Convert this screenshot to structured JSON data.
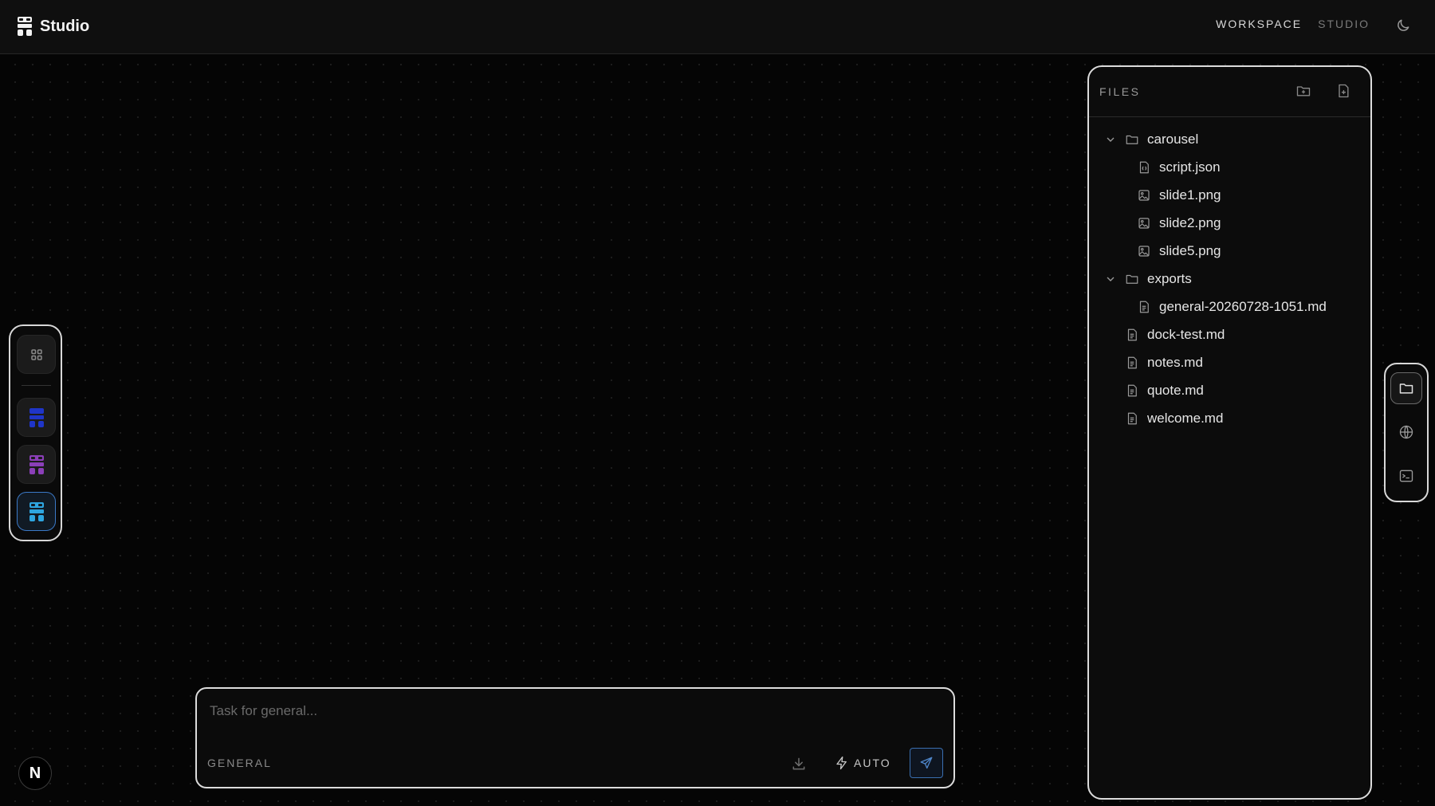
{
  "app": {
    "name": "Studio"
  },
  "nav": {
    "workspace": "WORKSPACE",
    "studio": "STUDIO"
  },
  "theme_toggle_icon": "moon-icon",
  "left_rail": {
    "items": [
      {
        "icon": "grid-icon",
        "color": "#8a8a8a"
      },
      {
        "icon": "agent-icon",
        "color": "#1f35c8"
      },
      {
        "icon": "agent-icon",
        "color": "#8b3fb8"
      },
      {
        "icon": "agent-icon",
        "color": "#2ea6e0",
        "active": true
      }
    ]
  },
  "avatar": {
    "initial": "N"
  },
  "composer": {
    "placeholder": "Task for general...",
    "mode": "GENERAL",
    "auto_label": "AUTO"
  },
  "files": {
    "title": "FILES",
    "tree": [
      {
        "label": "carousel",
        "type": "folder",
        "expanded": true,
        "depth": 0
      },
      {
        "label": "script.json",
        "type": "json",
        "depth": 1
      },
      {
        "label": "slide1.png",
        "type": "image",
        "depth": 1
      },
      {
        "label": "slide2.png",
        "type": "image",
        "depth": 1
      },
      {
        "label": "slide5.png",
        "type": "image",
        "depth": 1
      },
      {
        "label": "exports",
        "type": "folder",
        "expanded": true,
        "depth": 0
      },
      {
        "label": "general-20260728-1051.md",
        "type": "doc",
        "depth": 1
      },
      {
        "label": "dock-test.md",
        "type": "doc",
        "depth": 0
      },
      {
        "label": "notes.md",
        "type": "doc",
        "depth": 0
      },
      {
        "label": "quote.md",
        "type": "doc",
        "depth": 0
      },
      {
        "label": "welcome.md",
        "type": "doc",
        "depth": 0
      }
    ]
  },
  "right_dock": {
    "items": [
      {
        "icon": "folder-icon",
        "active": true
      },
      {
        "icon": "globe-icon"
      },
      {
        "icon": "terminal-icon"
      }
    ]
  },
  "colors": {
    "accent": "#3b79c7",
    "background": "#050505",
    "panel_border": "#dcdcdc"
  }
}
